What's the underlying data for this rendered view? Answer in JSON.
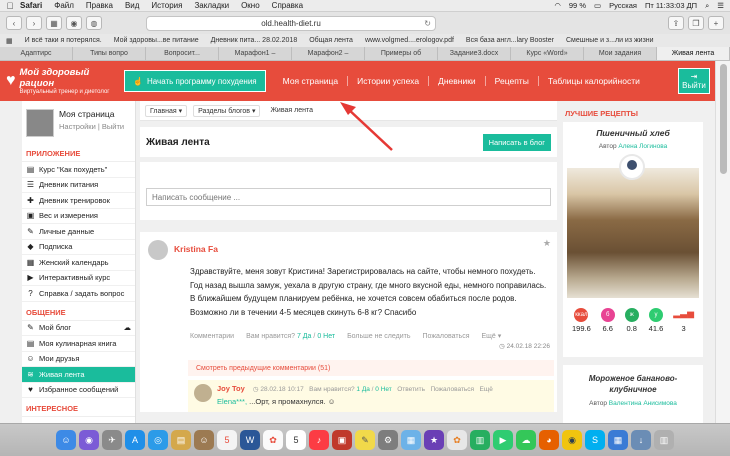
{
  "menubar": {
    "app": "Safari",
    "items": [
      "Файл",
      "Правка",
      "Вид",
      "История",
      "Закладки",
      "Окно",
      "Справка"
    ],
    "battery": "99 %",
    "input_lang": "Русская",
    "clock": "Пт 11:33:03 ДП"
  },
  "browser": {
    "url": "old.health-diet.ru",
    "bookmarks": [
      "И всё таки я потерялся.",
      "Мой здоровы...ве питание",
      "Дневник пита... 28.02.2018",
      "Общая лента",
      "www.volgmed....erologov.pdf",
      "Вся база англ...lary Booster",
      "Смешные и з...ли из жизни"
    ],
    "tabs": [
      "Адаптирс",
      "Типы вопро",
      "Вопросит...",
      "Марафон1 –",
      "Марафон2 –",
      "Примеры об",
      "Задание3.docx",
      "Курс «Word»",
      "Мои задания",
      "Живая лента"
    ]
  },
  "header": {
    "logo_title": "Мой здоровый рацион",
    "logo_subtitle": "Виртуальный тренер и диетолог",
    "start_button": "Начать программу похудения",
    "nav": [
      "Моя страница",
      "Истории успеха",
      "Дневники",
      "Рецепты",
      "Таблицы калорийности"
    ],
    "exit_label": "Выйти"
  },
  "sidebar": {
    "profile_name": "Моя страница",
    "settings_link": "Настройки",
    "exit_link": "Выйти",
    "section_app": "ПРИЛОЖЕНИЕ",
    "app_items": [
      "Курс \"Как похудеть\"",
      "Дневник питания",
      "Дневник тренировок",
      "Вес и измерения",
      "Личные данные",
      "Подписка",
      "Женский календарь",
      "Интерактивный курс",
      "Справка / задать вопрос"
    ],
    "section_social": "ОБЩЕНИЕ",
    "social_items": [
      "Мой блог",
      "Моя кулинарная книга",
      "Мои друзья",
      "Живая лента",
      "Избранное сообщений"
    ],
    "section_more": "ИНТЕРЕСНОЕ"
  },
  "breadcrumbs": {
    "home": "Главная",
    "blogs": "Разделы блогов",
    "current": "Живая лента"
  },
  "feed": {
    "title": "Живая лента",
    "publish_button": "Написать в блог",
    "message_placeholder": "Написать сообщение ..."
  },
  "post": {
    "author": "Kristina Fa",
    "text": "Здравствуйте, меня зовут Кристина! Зарегистрировалась на сайте, чтобы немного похудеть. Год назад вышла замуж, уехала в другую страну, где много вкусной еды, немного поправилась. В ближайшем будущем планируем ребёнка, не хочется совсем обабиться после родов. Возможно ли в течении 4-5 месяцев скинуть 6-8 кг? Спасибо",
    "comments_label": "Комментарии",
    "like_question": "Вам нравится?",
    "yes": "7 Да",
    "sep": "/",
    "no": "0 Нет",
    "unfollow": "Больше не следить",
    "complain": "Пожаловаться",
    "more": "Ещё",
    "date": "24.02.18 22:26",
    "prev_comments": "Смотреть предыдущие комментарии (51)"
  },
  "comment": {
    "author": "Joy Toy",
    "date": "28.02.18 10:17",
    "like_question": "Вам нравится?",
    "yes": "1 Да",
    "sep": "/",
    "no": "0 Нет",
    "reply": "Ответить",
    "complain": "Пожаловаться",
    "more": "Ещё",
    "mention": "Elena***,",
    "text": " ...Орт, я промахнулся."
  },
  "right": {
    "section": "ЛУЧШИЕ РЕЦЕПТЫ",
    "recipe1_name": "Пшеничный хлеб",
    "author_prefix": "Автор",
    "recipe1_author": "Алена Логинова",
    "nutrition": [
      {
        "label": "ккал",
        "value": "199.6",
        "color": "#e74c3c"
      },
      {
        "label": "б",
        "value": "6.6",
        "color": "#e84393"
      },
      {
        "label": "ж",
        "value": "0.8",
        "color": "#27ae60"
      },
      {
        "label": "у",
        "value": "41.6",
        "color": "#2ecc71"
      },
      {
        "label": "",
        "value": "3",
        "color": "#e74c3c"
      }
    ],
    "recipe2_name": "Мороженое бананово-клубничное",
    "recipe2_author": "Валентина Анисимова"
  }
}
